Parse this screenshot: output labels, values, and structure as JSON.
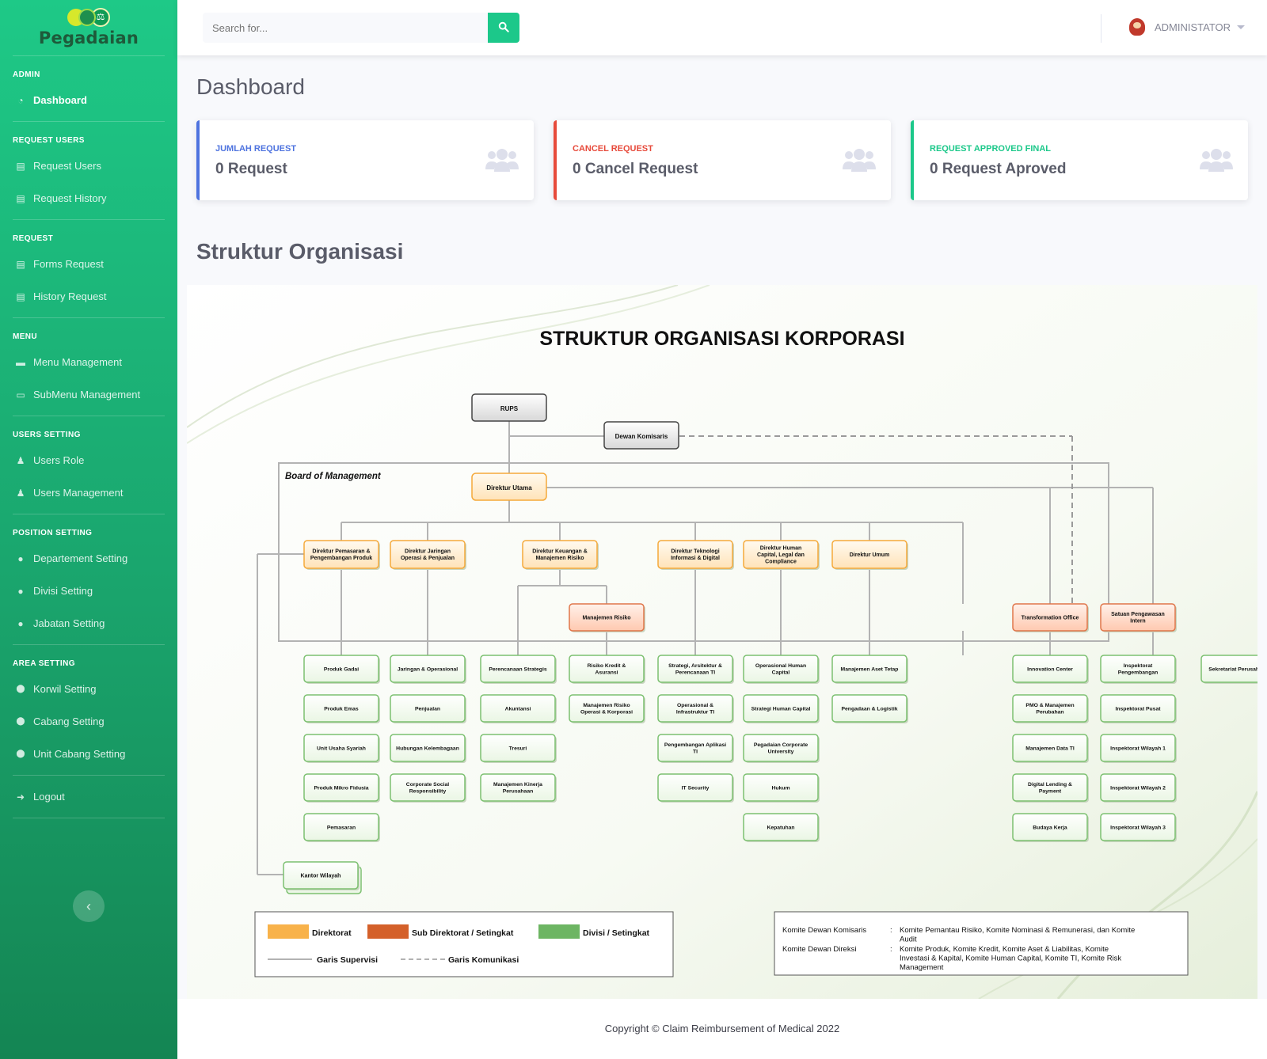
{
  "brand": {
    "name": "Pegadaian",
    "logo_icon": "scale-icon"
  },
  "sidebar": {
    "sections": [
      {
        "heading": "ADMIN",
        "items": [
          {
            "label": "Dashboard",
            "icon": "dashboard-icon",
            "active": true
          }
        ]
      },
      {
        "heading": "REQUEST USERS",
        "items": [
          {
            "label": "Request Users",
            "icon": "book-icon"
          },
          {
            "label": "Request History",
            "icon": "book-icon"
          }
        ]
      },
      {
        "heading": "REQUEST",
        "items": [
          {
            "label": "Forms Request",
            "icon": "book-icon"
          },
          {
            "label": "History Request",
            "icon": "book-icon"
          }
        ]
      },
      {
        "heading": "MENU",
        "items": [
          {
            "label": "Menu Management",
            "icon": "folder-icon"
          },
          {
            "label": "SubMenu Management",
            "icon": "folder-open-icon"
          }
        ]
      },
      {
        "heading": "USERS SETTING",
        "items": [
          {
            "label": "Users Role",
            "icon": "user-tie-icon"
          },
          {
            "label": "Users Management",
            "icon": "user-tie-icon"
          }
        ]
      },
      {
        "heading": "POSITION SETTING",
        "items": [
          {
            "label": "Departement Setting",
            "icon": "user-icon"
          },
          {
            "label": "Divisi Setting",
            "icon": "user-icon"
          },
          {
            "label": "Jabatan Setting",
            "icon": "user-icon"
          }
        ]
      },
      {
        "heading": "AREA SETTING",
        "items": [
          {
            "label": "Korwil Setting",
            "icon": "map-marker-icon"
          },
          {
            "label": "Cabang Setting",
            "icon": "map-marker-icon"
          },
          {
            "label": "Unit Cabang Setting",
            "icon": "map-marker-icon"
          }
        ]
      }
    ],
    "logout_label": "Logout",
    "toggle_icon": "chevron-left-icon"
  },
  "topbar": {
    "search_placeholder": "Search for...",
    "search_icon": "search-icon",
    "user_name": "ADMINISTATOR"
  },
  "page": {
    "title": "Dashboard"
  },
  "cards": [
    {
      "label": "JUMLAH REQUEST",
      "value": "0 Request",
      "color": "#4e73df",
      "icon": "users-icon"
    },
    {
      "label": "CANCEL REQUEST",
      "value": "0 Cancel Request",
      "color": "#e74a3b",
      "icon": "users-icon"
    },
    {
      "label": "REQUEST APPROVED FINAL",
      "value": "0 Request Aproved",
      "color": "#1cc88a",
      "icon": "users-icon"
    }
  ],
  "org": {
    "section_title": "Struktur Organisasi",
    "heading": "STRUKTUR ORGANISASI KORPORASI",
    "rups": "RUPS",
    "dewan": "Dewan Komisaris",
    "bom": "Board of Management",
    "dirut": "Direktur Utama",
    "directors": [
      "Direktur Pemasaran & Pengembangan Produk",
      "Direktur Jaringan Operasi & Penjualan",
      "Direktur Keuangan & Manajemen Risiko",
      "Direktur Teknologi Informasi & Digital",
      "Direktur Human Capital, Legal dan Compliance",
      "Direktur Umum"
    ],
    "subs": [
      "Manajemen Risiko",
      "Transformation Office",
      "Satuan Pengawasan Intern"
    ],
    "columns": [
      [
        "Produk Gadai",
        "Produk Emas",
        "Unit Usaha Syariah",
        "Produk Mikro Fidusia",
        "Pemasaran"
      ],
      [
        "Jaringan & Operasional",
        "Penjualan",
        "Hubungan Kelembagaan",
        "Corporate Social Responsibility"
      ],
      [
        "Perencanaan Strategis",
        "Akuntansi",
        "Tresuri",
        "Manajemen Kinerja Perusahaan"
      ],
      [
        "Risiko Kredit & Asuransi",
        "Manajemen Risiko Operasi & Korporasi"
      ],
      [
        "Strategi, Arsitektur & Perencanaan TI",
        "Operasional & Infrastruktur TI",
        "Pengembangan Aplikasi TI",
        "IT Security"
      ],
      [
        "Operasional Human Capital",
        "Strategi Human Capital",
        "Pegadaian Corporate University",
        "Hukum",
        "Kepatuhan"
      ],
      [
        "Manajemen Aset Tetap",
        "Pengadaan & Logistik"
      ],
      [
        "Innovation Center",
        "PMO & Manajemen Perubahan",
        "Manajemen Data TI",
        "Digital Lending & Payment",
        "Budaya Kerja"
      ],
      [
        "Inspektorat Pengembangan",
        "Inspektorat Pusat",
        "Inspektorat Wilayah 1",
        "Inspektorat Wilayah 2",
        "Inspektorat Wilayah 3"
      ],
      [
        "Sekretariat Perusahaan"
      ]
    ],
    "kantor": "Kantor Wilayah",
    "legend": {
      "direktorat": "Direktorat",
      "sub": "Sub Direktorat / Setingkat",
      "divisi": "Divisi / Setingkat",
      "supervisi": "Garis Supervisi",
      "komunikasi": "Garis Komunikasi",
      "colors": {
        "direktorat": "#f8b24a",
        "sub": "#d4602a",
        "divisi": "#6db563"
      }
    },
    "komite": [
      {
        "key": "Komite Dewan Komisaris",
        "sep": ":",
        "value": "Komite Pemantau Risiko, Komite Nominasi & Remunerasi, dan Komite Audit"
      },
      {
        "key": "Komite Dewan Direksi",
        "sep": ":",
        "value": "Komite Produk, Komite Kredit, Komite Aset & Liabilitas, Komite Investasi & Kapital, Komite Human Capital, Komite TI, Komite Risk Management"
      }
    ]
  },
  "footer": {
    "text": "Copyright © Claim Reimbursement of Medical 2022"
  }
}
